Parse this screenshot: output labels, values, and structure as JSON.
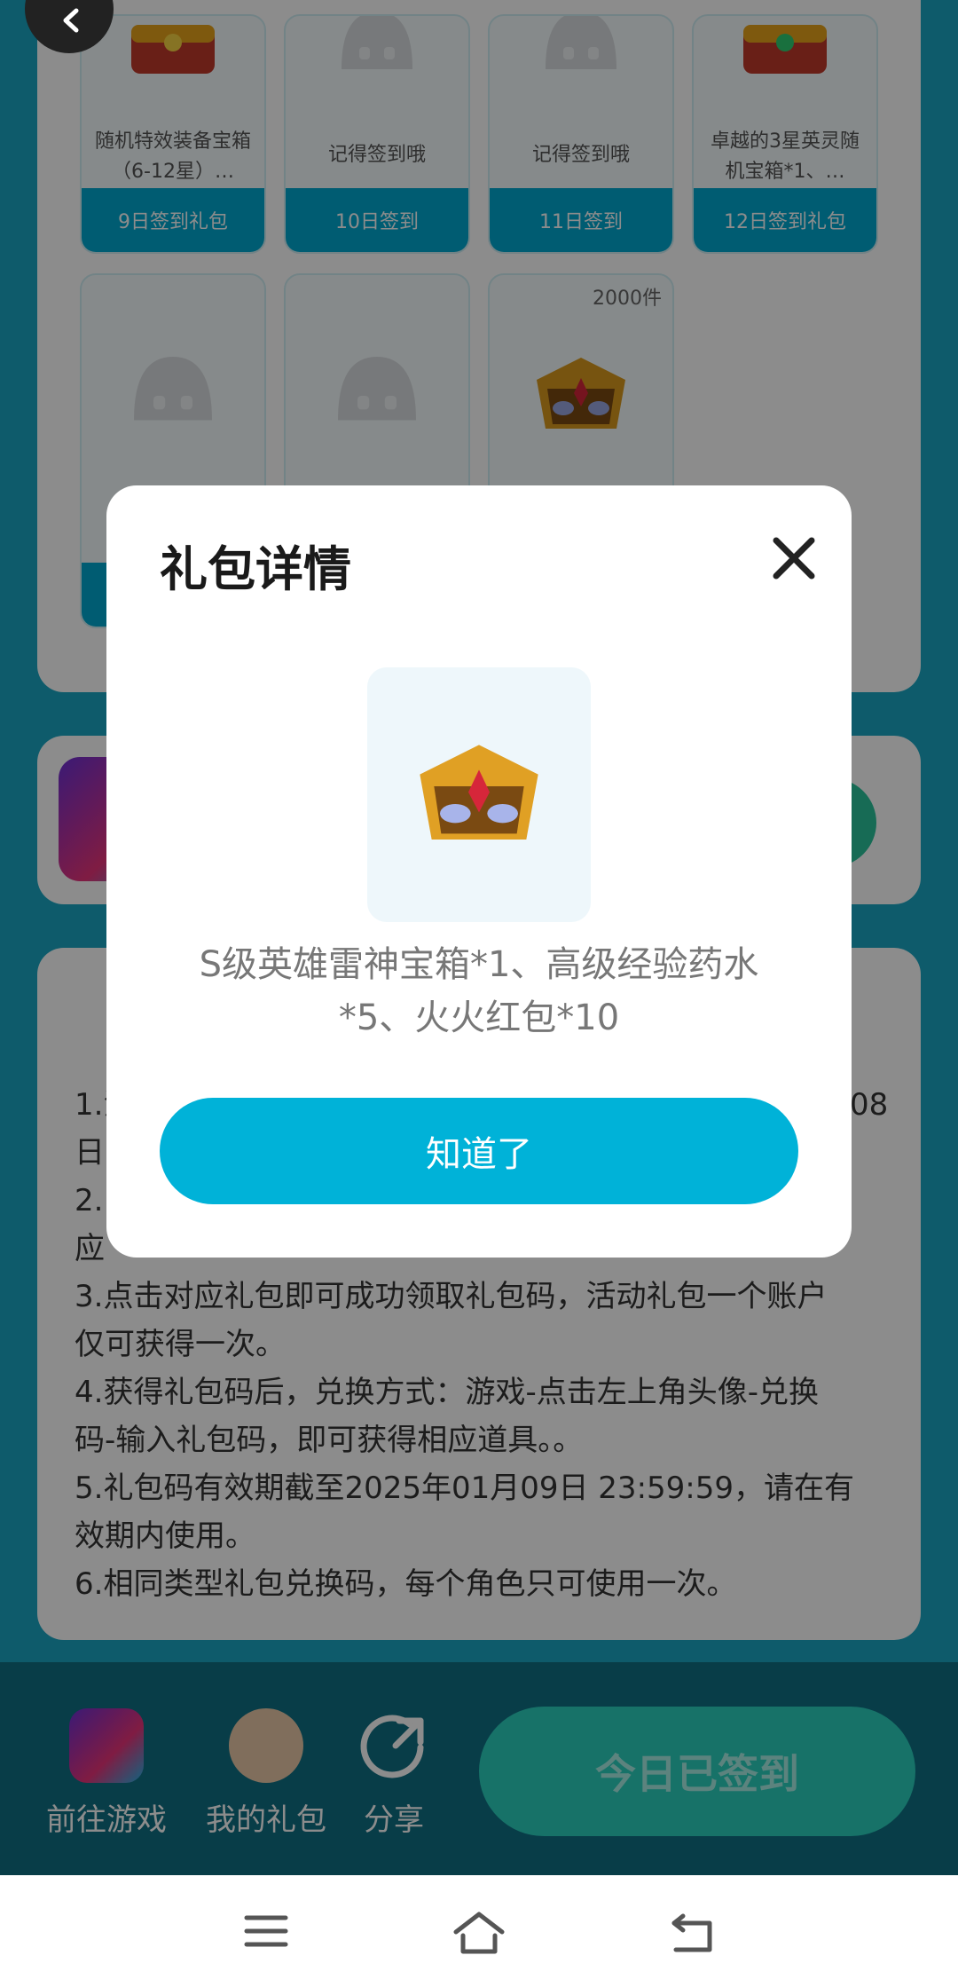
{
  "gift_grid": {
    "row1": [
      {
        "desc": "随机特效装备宝箱（6-12星）…",
        "foot": "9日签到礼包",
        "thumb": "treasure-chest"
      },
      {
        "desc": "记得签到哦",
        "foot": "10日签到",
        "thumb": "placeholder-mascot"
      },
      {
        "desc": "记得签到哦",
        "foot": "11日签到",
        "thumb": "placeholder-mascot"
      },
      {
        "desc": "卓越的3星英灵随机宝箱*1、…",
        "foot": "12日签到礼包",
        "thumb": "treasure-chest"
      }
    ],
    "row2_count_badge": "2000件"
  },
  "rules": {
    "lines": [
      "1.活",
      "日",
      "2.",
      "应",
      "3.点击对应礼包即可成功领取礼包码，活动礼包一个账户",
      "仅可获得一次。",
      "4.获得礼包码后，兑换方式：游戏-点击左上角头像-兑换",
      "码-输入礼包码，即可获得相应道具。。",
      "5.礼包码有效期截至2025年01月09日 23:59:59，请在有",
      "效期内使用。",
      "6.相同类型礼包兑换码，每个角色只可使用一次。"
    ],
    "right_fragment": "08"
  },
  "bottom_bar": {
    "game_label": "前往游戏",
    "gifts_label": "我的礼包",
    "share_label": "分享",
    "signed_label": "今日已签到"
  },
  "modal": {
    "title": "礼包详情",
    "prize_text": "S级英雄雷神宝箱*1、高级经验药水*5、火火红包*10",
    "ok_label": "知道了"
  },
  "colors": {
    "accent": "#00b2d8",
    "page_bg": "#1aa7c3",
    "signed_btn": "#2ad0be"
  }
}
